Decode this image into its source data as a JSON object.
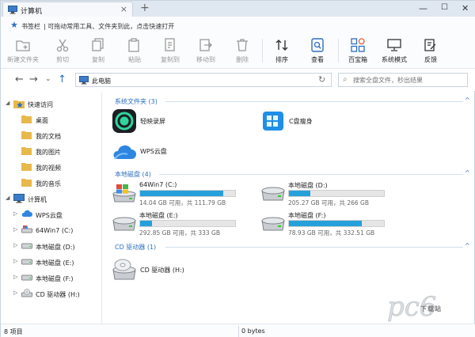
{
  "tab": {
    "title": "计算机"
  },
  "bookmarks": {
    "label": "书签栏",
    "hint": "| 可拖动常用工具、文件夹到此，点击快速打开"
  },
  "toolbar": [
    {
      "id": "new-folder",
      "label": "新建文件夹",
      "enabled": false
    },
    {
      "id": "cut",
      "label": "剪切",
      "enabled": false
    },
    {
      "id": "copy",
      "label": "复制",
      "enabled": false
    },
    {
      "id": "paste",
      "label": "粘贴",
      "enabled": false
    },
    {
      "id": "copy-to",
      "label": "复制到",
      "enabled": false
    },
    {
      "id": "move-to",
      "label": "移动到",
      "enabled": false
    },
    {
      "id": "delete",
      "label": "删除",
      "enabled": false
    },
    {
      "id": "sort",
      "label": "排序",
      "enabled": true
    },
    {
      "id": "view",
      "label": "查看",
      "enabled": true
    },
    {
      "id": "toolbox",
      "label": "百宝箱",
      "enabled": true
    },
    {
      "id": "system-mode",
      "label": "系统模式",
      "enabled": true
    },
    {
      "id": "feedback",
      "label": "反馈",
      "enabled": true
    }
  ],
  "address": {
    "path": "此电脑"
  },
  "search": {
    "placeholder": "搜索全盘文件，秒出结果"
  },
  "sidebar": {
    "quick_access": "快速访问",
    "quick_items": [
      "桌面",
      "我的文档",
      "我的图片",
      "我的视频",
      "我的音乐"
    ],
    "computer": "计算机",
    "computer_items": [
      "WPS云盘",
      "64Win7 (C:)",
      "本地磁盘 (D:)",
      "本地磁盘 (E:)",
      "本地磁盘 (F:)",
      "CD 驱动器 (H:)"
    ]
  },
  "sections": {
    "system_folders": "系统文件夹 (3)",
    "local_disks": "本地磁盘 (4)",
    "cd_drives": "CD 驱动器 (1)"
  },
  "system_folders": [
    {
      "name": "轻映录屏",
      "icon": "screen-recorder-icon"
    },
    {
      "name": "C盘瘦身",
      "icon": "c-drive-cleanup-icon"
    },
    {
      "name": "WPS云盘",
      "icon": "wps-cloud-icon"
    }
  ],
  "drives": [
    {
      "name": "64Win7 (C:)",
      "stats": "14.04 GB 可用，共 111.79 GB",
      "used_fraction": 0.874,
      "os": true
    },
    {
      "name": "本地磁盘 (D:)",
      "stats": "205.27 GB 可用，共 266 GB",
      "used_fraction": 0.228
    },
    {
      "name": "本地磁盘 (E:)",
      "stats": "292.85 GB 可用，共 333 GB",
      "used_fraction": 0.121
    },
    {
      "name": "本地磁盘 (F:)",
      "stats": "78.93 GB 可用，共 332.51 GB",
      "used_fraction": 0.763
    }
  ],
  "cd": {
    "name": "CD 驱动器 (H:)"
  },
  "status": {
    "items": "8 项目",
    "size": "0 bytes"
  },
  "watermark": {
    "brand": "下载站"
  },
  "colors": {
    "accent": "#2f6fbf",
    "bar_fill": "#26a0da",
    "bar_bg": "#e6e6e6"
  }
}
